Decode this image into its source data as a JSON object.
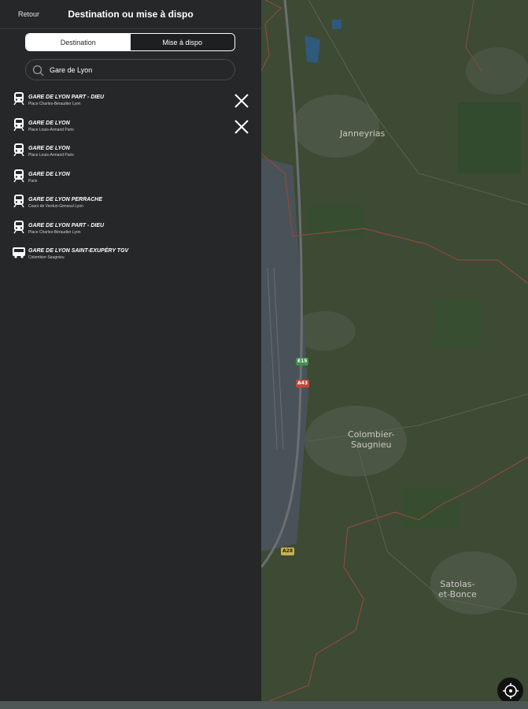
{
  "header": {
    "back_label": "Retour",
    "title": "Destination ou mise à dispo"
  },
  "tabs": [
    {
      "label": "Destination",
      "active": true
    },
    {
      "label": "Mise à dispo",
      "active": false
    }
  ],
  "search": {
    "value": "Gare de Lyon",
    "icon": "search-icon"
  },
  "results": [
    {
      "name": "GARE DE LYON PART - DIEU",
      "address": "Place Charles-Béraudier Lyon",
      "icon": "train-icon",
      "removable": true
    },
    {
      "name": "GARE DE LYON",
      "address": "Place Louis-Armand Paris",
      "icon": "train-icon",
      "removable": true
    },
    {
      "name": "GARE DE LYON",
      "address": "Place Louis-Armand Paris",
      "icon": "train-icon",
      "removable": false
    },
    {
      "name": "GARE DE LYON",
      "address": "Paris",
      "icon": "train-icon",
      "removable": false
    },
    {
      "name": "GARE DE LYON PERRACHE",
      "address": "Cours de Verdun-Gensoul Lyon",
      "icon": "train-icon",
      "removable": false
    },
    {
      "name": "GARE DE LYON PART - DIEU",
      "address": "Place Charles-Béraudier Lyon",
      "icon": "train-icon",
      "removable": false
    },
    {
      "name": "GARE DE LYON SAINT-EXUPÉRY TGV",
      "address": "Colombier-Saugnieu",
      "icon": "bus-icon",
      "removable": false
    }
  ],
  "map": {
    "places": [
      "Janneyrias",
      "Colombier-\nSaugnieu",
      "Satolas-\net-Bonce"
    ],
    "road_badges": [
      {
        "label": "E15",
        "color": "#3f8f4f"
      },
      {
        "label": "A43",
        "color": "#c4453c"
      },
      {
        "label": "A28",
        "color": "#c9b34a"
      }
    ],
    "locate_icon": "crosshair-icon"
  }
}
